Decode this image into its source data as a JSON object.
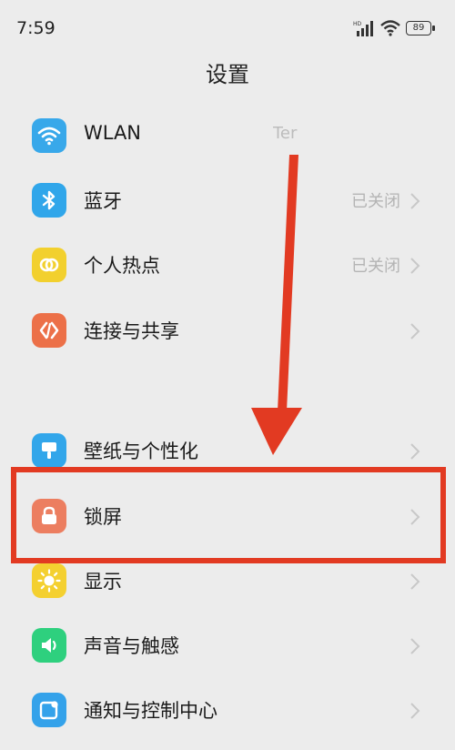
{
  "status_bar": {
    "time": "7:59",
    "battery": "89"
  },
  "page": {
    "title": "设置"
  },
  "settings": {
    "wlan": {
      "label": "WLAN",
      "value": "Ter",
      "color": "#38a8ea"
    },
    "bluetooth": {
      "label": "蓝牙",
      "value": "已关闭",
      "color": "#30a6ea"
    },
    "hotspot": {
      "label": "个人热点",
      "value": "已关闭",
      "color": "#f2d02e"
    },
    "connection": {
      "label": "连接与共享",
      "color": "#ec7048"
    },
    "wallpaper": {
      "label": "壁纸与个性化",
      "color": "#32a6ea"
    },
    "lockscreen": {
      "label": "锁屏",
      "color": "#ec7e60"
    },
    "display": {
      "label": "显示",
      "color": "#f4d030"
    },
    "sound": {
      "label": "声音与触感",
      "color": "#2ed07e"
    },
    "notification": {
      "label": "通知与控制中心",
      "color": "#34a2ea"
    }
  },
  "annotation": {
    "color": "#e23a22"
  },
  "icons": [
    "wifi-icon",
    "bluetooth-icon",
    "hotspot-icon",
    "share-icon",
    "wallpaper-icon",
    "lock-icon",
    "sun-icon",
    "speaker-icon",
    "notification-icon",
    "chevron-right-icon"
  ]
}
